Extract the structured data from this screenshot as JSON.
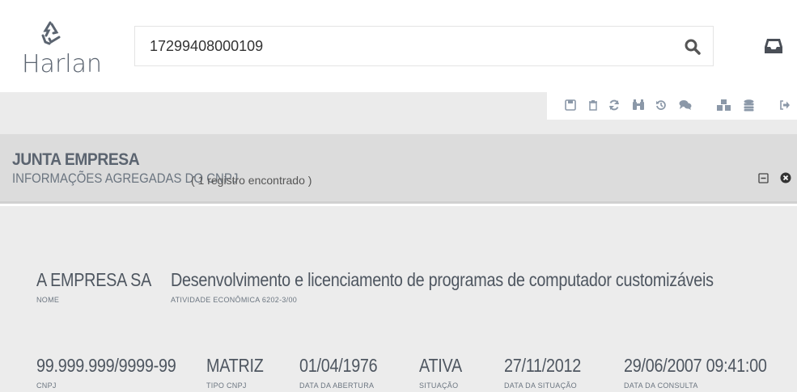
{
  "header": {
    "logo_text": "Harlan",
    "search_value": "17299408000109"
  },
  "toolbar": {
    "icons": [
      "save-icon",
      "trash-icon",
      "refresh-icon",
      "binoculars-icon",
      "history-icon",
      "comments-icon",
      "cubes-icon",
      "database-icon",
      "logout-icon"
    ]
  },
  "panel": {
    "title": "JUNTA EMPRESA",
    "subtitle": "INFORMAÇÕES AGREGADAS DO CNPJ",
    "count": "( 1 registro encontrado )"
  },
  "fields": {
    "nome": {
      "value": "A EMPRESA SA",
      "label": "NOME"
    },
    "atividade": {
      "value": "Desenvolvimento e licenciamento de programas de computador customizáveis",
      "label": "ATIVIDADE ECONÔMICA 6202-3/00"
    },
    "cnpj": {
      "value": "99.999.999/9999-99",
      "label": "CNPJ"
    },
    "tipo": {
      "value": "MATRIZ",
      "label": "TIPO CNPJ"
    },
    "abertura": {
      "value": "01/04/1976",
      "label": "DATA DA ABERTURA"
    },
    "situacao": {
      "value": "ATIVA",
      "label": "SITUAÇÃO"
    },
    "data_situacao": {
      "value": "27/11/2012",
      "label": "DATA DA SITUAÇÃO"
    },
    "consulta": {
      "value": "29/06/2007 09:41:00",
      "label": "DATA DA CONSULTA"
    }
  },
  "colors": {
    "accent": "#5b6470",
    "panel_bg": "#ececec",
    "panel_head": "#dcdcdc"
  }
}
